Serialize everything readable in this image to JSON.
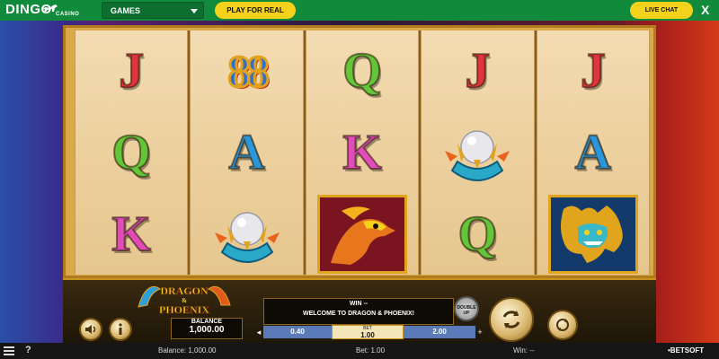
{
  "topbar": {
    "logo_text": "DINGO",
    "logo_sub": "CASINO",
    "games_select": "GAMES",
    "play_real": "PLAY FOR REAL",
    "live_chat": "LIVE CHAT",
    "close": "X"
  },
  "reels": [
    [
      "J",
      "Q",
      "K"
    ],
    [
      "88",
      "A",
      "pearl"
    ],
    [
      "Q",
      "K",
      "phoenix"
    ],
    [
      "J",
      "pearl",
      "Q"
    ],
    [
      "J",
      "A",
      "dragon"
    ]
  ],
  "game_logo": {
    "line1": "DRAGON",
    "line2": "&",
    "line3": "PHOENIX"
  },
  "balance_box": {
    "label": "BALANCE",
    "value": "1,000.00"
  },
  "message": {
    "win": "WIN --",
    "welcome": "WELCOME TO DRAGON & PHOENIX!"
  },
  "double_up": {
    "line1": "DOUBLE",
    "line2": "UP"
  },
  "bet_strip": {
    "minus": "◂",
    "low": "0.40",
    "bet_label": "BET",
    "bet_value": "1.00",
    "high": "2.00",
    "plus": "+"
  },
  "statusbar": {
    "balance": "Balance: 1,000.00",
    "bet": "Bet: 1.00",
    "win": "Win: --",
    "help": "?",
    "brand": "•BETSOFT"
  },
  "colors": {
    "topbar": "#128a3c",
    "yellow_button": "#f4d21c",
    "frame_gold": "#d9a94a"
  }
}
